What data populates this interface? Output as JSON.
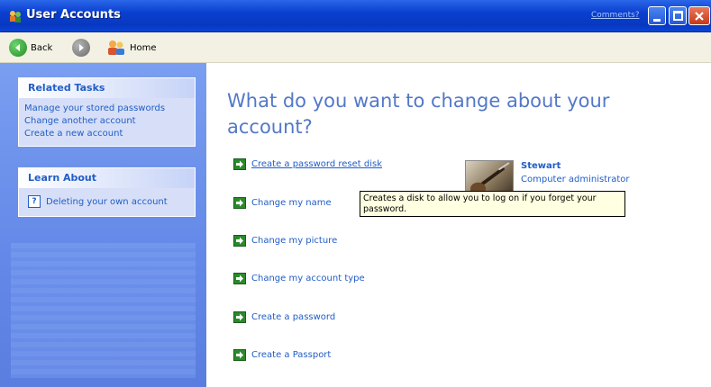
{
  "window": {
    "title": "User Accounts",
    "comments_link": "Comments?"
  },
  "toolbar": {
    "back_label": "Back",
    "home_label": "Home"
  },
  "sidebar": {
    "related_tasks": {
      "header": "Related Tasks",
      "links": [
        "Manage your stored passwords",
        "Change another account",
        "Create a new account"
      ]
    },
    "learn_about": {
      "header": "Learn About",
      "items": [
        "Deleting your own account"
      ]
    }
  },
  "main": {
    "heading": "What do you want to change about your account?",
    "tasks": [
      "Create a password reset disk",
      "Change my name",
      "Change my picture",
      "Change my account type",
      "Create a password",
      "Create a Passport"
    ],
    "user": {
      "name": "Stewart",
      "role": "Computer administrator"
    },
    "tooltip": "Creates a disk to allow you to log on if you forget your password."
  },
  "colors": {
    "titlebar": "#0a3fd0",
    "sidebar": "#6388e8",
    "link": "#215dc6",
    "heading": "#5378c8",
    "task_arrow": "#2a8a2a",
    "tooltip_bg": "#ffffe1"
  },
  "icons": {
    "title": "user-accounts-icon",
    "back": "back-arrow-icon",
    "forward": "forward-arrow-icon",
    "home": "home-users-icon",
    "help": "help-icon",
    "task": "green-arrow-icon"
  }
}
